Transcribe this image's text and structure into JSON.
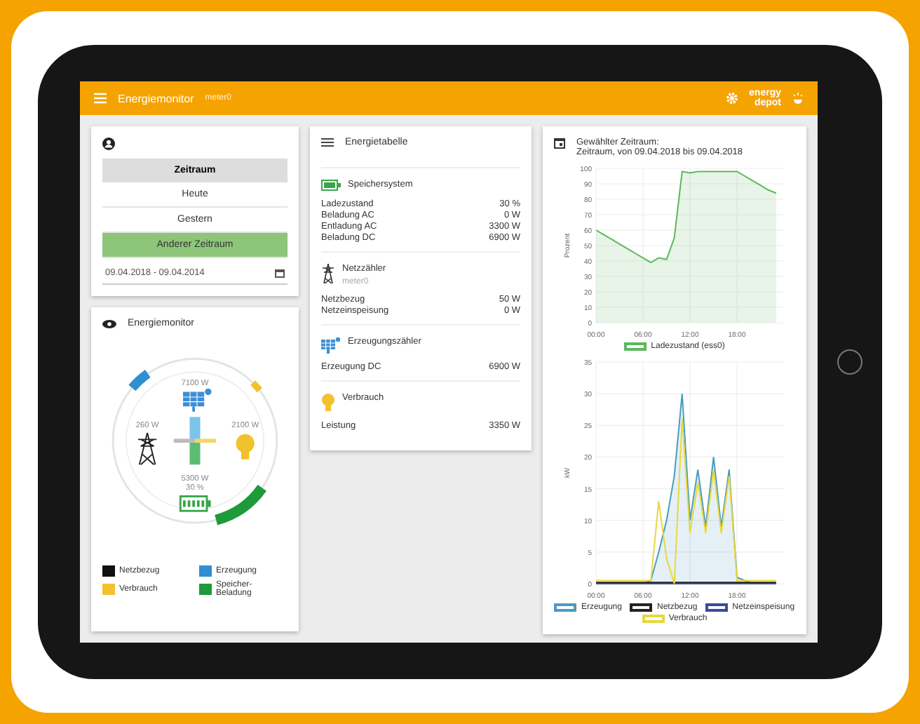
{
  "header": {
    "title": "Energiemonitor",
    "subtitle": "meter0",
    "logo": [
      "energy",
      "depot"
    ]
  },
  "period": {
    "heading": "Zeitraum",
    "options": [
      {
        "label": "Heute",
        "selected": false
      },
      {
        "label": "Gestern",
        "selected": false
      },
      {
        "label": "Anderer Zeitraum",
        "selected": true
      }
    ],
    "date_range": "09.04.2018 - 09.04.2014"
  },
  "energy_monitor": {
    "title": "Energiemonitor",
    "readings": {
      "production": "7100 W",
      "grid": "260 W",
      "consumption": "2100 W",
      "storage": "5300 W",
      "storage_soc": "30 %"
    },
    "legend": [
      {
        "label": "Netzbezug",
        "color": "#111111"
      },
      {
        "label": "Erzeugung",
        "color": "#2f8fd0"
      },
      {
        "label": "Verbrauch",
        "color": "#f2c12e"
      },
      {
        "label": "Speicher-Beladung",
        "color": "#1f9a3a"
      }
    ]
  },
  "energy_table": {
    "title": "Energietabelle",
    "sections": [
      {
        "kind": "storage",
        "title": "Speichersystem",
        "rows": [
          {
            "label": "Ladezustand",
            "value": "30 %"
          },
          {
            "label": "Beladung AC",
            "value": "0 W"
          },
          {
            "label": "Entladung AC",
            "value": "3300 W"
          },
          {
            "label": "Beladung DC",
            "value": "6900 W"
          }
        ]
      },
      {
        "kind": "grid",
        "title": "Netzzähler",
        "subtitle": "meter0",
        "rows": [
          {
            "label": "Netzbezug",
            "value": "50 W"
          },
          {
            "label": "Netzeinspeisung",
            "value": "0 W"
          }
        ]
      },
      {
        "kind": "production",
        "title": "Erzeugungszähler",
        "rows": [
          {
            "label": "Erzeugung DC",
            "value": "6900 W"
          }
        ]
      },
      {
        "kind": "consumption",
        "title": "Verbrauch",
        "rows": [
          {
            "label": "Leistung",
            "value": "3350 W"
          }
        ]
      }
    ]
  },
  "history": {
    "title": "Gewählter Zeitraum:",
    "range": "Zeitraum, von 09.04.2018 bis 09.04.2018",
    "charts": [
      {
        "chart_data": {
          "type": "area",
          "ylabel": "Prozent",
          "x": [
            0,
            1,
            2,
            3,
            4,
            5,
            6,
            7,
            8,
            9,
            10,
            11,
            12,
            13,
            14,
            15,
            16,
            17,
            18,
            19,
            20,
            21,
            22,
            23
          ],
          "xlim": [
            0,
            24
          ],
          "ylim": [
            0,
            100
          ],
          "xticks": [
            {
              "value": 0,
              "label": "00:00"
            },
            {
              "value": 6,
              "label": "06:00"
            },
            {
              "value": 12,
              "label": "12:00"
            },
            {
              "value": 18,
              "label": "18:00"
            }
          ],
          "yticks": [
            0,
            10,
            20,
            30,
            40,
            50,
            60,
            70,
            80,
            90,
            100
          ],
          "grid": true,
          "series": [
            {
              "name": "Ladezustand (ess0)",
              "color": "#5cb85c",
              "values": [
                60,
                57,
                54,
                51,
                48,
                45,
                42,
                39,
                42,
                41,
                55,
                98,
                97,
                98,
                98,
                98,
                98,
                98,
                98,
                95,
                92,
                89,
                86,
                84
              ]
            }
          ]
        }
      },
      {
        "chart_data": {
          "type": "line",
          "ylabel": "kW",
          "x": [
            0,
            1,
            2,
            3,
            4,
            5,
            6,
            7,
            8,
            9,
            10,
            11,
            12,
            13,
            14,
            15,
            16,
            17,
            18,
            19,
            20,
            21,
            22,
            23
          ],
          "xlim": [
            0,
            24
          ],
          "ylim": [
            0,
            35
          ],
          "xticks": [
            {
              "value": 0,
              "label": "00:00"
            },
            {
              "value": 6,
              "label": "06:00"
            },
            {
              "value": 12,
              "label": "12:00"
            },
            {
              "value": 18,
              "label": "18:00"
            }
          ],
          "yticks": [
            0,
            5,
            10,
            15,
            20,
            25,
            30,
            35
          ],
          "grid": true,
          "series": [
            {
              "name": "Erzeugung",
              "color": "#4a9cc0",
              "values": [
                null,
                null,
                null,
                null,
                null,
                null,
                0,
                0.5,
                5,
                10,
                17,
                30,
                10,
                18,
                9,
                20,
                9,
                18,
                1,
                0.5,
                0,
                null,
                null,
                null
              ]
            },
            {
              "name": "Netzbezug",
              "color": "#222222",
              "values": [
                0.2,
                0.2,
                0.2,
                0.2,
                0.2,
                0.2,
                0.2,
                0.2,
                0.2,
                0.2,
                0.2,
                0.2,
                0.2,
                0.2,
                0.2,
                0.2,
                0.2,
                0.2,
                0.2,
                0.2,
                0.2,
                0.2,
                0.2,
                0.2
              ]
            },
            {
              "name": "Netzeinspeisung",
              "color": "#3a4aa0",
              "values": [
                0,
                0,
                0,
                0,
                0,
                0,
                0,
                0,
                0,
                0,
                0,
                0,
                0,
                0,
                0,
                0,
                0,
                0,
                0,
                0,
                0,
                0,
                0,
                0
              ]
            },
            {
              "name": "Verbrauch",
              "color": "#e8d840",
              "values": [
                0.5,
                0.5,
                0.5,
                0.5,
                0.5,
                0.5,
                0.5,
                0.5,
                13,
                4,
                0,
                26,
                8,
                16,
                8,
                18,
                8,
                17,
                0.5,
                0.5,
                0.5,
                0.5,
                0.5,
                0.5
              ]
            }
          ]
        }
      }
    ]
  }
}
